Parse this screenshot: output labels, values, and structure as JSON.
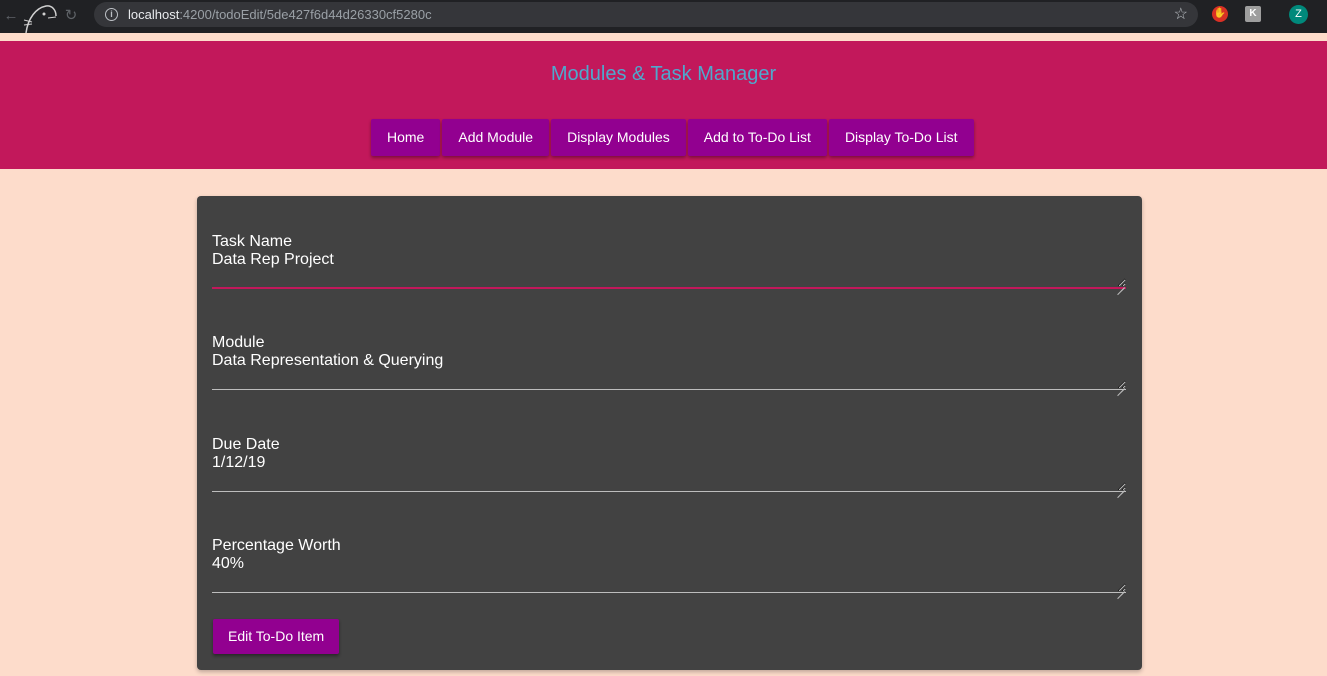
{
  "browser": {
    "url_host": "localhost",
    "url_path": ":4200/todoEdit/5de427f6d44d26330cf5280c",
    "avatar_letter": "Z"
  },
  "header": {
    "title": "Modules & Task Manager",
    "title_color": "#4fa8cd",
    "background": "#c2185b",
    "nav": [
      {
        "label": "Home"
      },
      {
        "label": "Add Module"
      },
      {
        "label": "Display Modules"
      },
      {
        "label": "Add to To-Do List"
      },
      {
        "label": "Display To-Do List"
      }
    ]
  },
  "form": {
    "fields": [
      {
        "label": "Task Name",
        "value": "Data Rep Project"
      },
      {
        "label": "Module",
        "value": "Data Representation & Querying"
      },
      {
        "label": "Due Date",
        "value": "1/12/19"
      },
      {
        "label": "Percentage Worth",
        "value": "40%"
      }
    ],
    "submit_label": "Edit To-Do Item"
  },
  "colors": {
    "page_background": "#fddccb",
    "button": "#920090",
    "card": "#424242"
  }
}
